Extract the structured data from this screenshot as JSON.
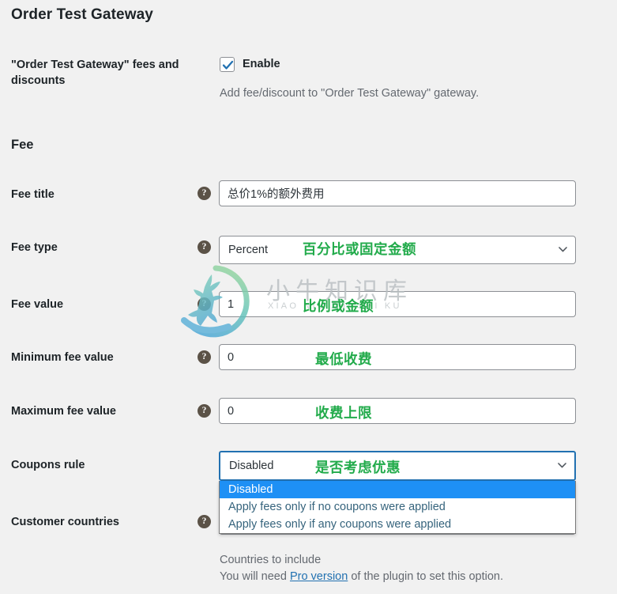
{
  "page": {
    "title": "Order Test Gateway"
  },
  "enable_row": {
    "label": "\"Order Test Gateway\" fees and discounts",
    "checkbox_label": "Enable",
    "checked": true,
    "description": "Add fee/discount to \"Order Test Gateway\" gateway."
  },
  "sections": {
    "fee": "Fee"
  },
  "fields": {
    "fee_title": {
      "label": "Fee title",
      "value": "总价1%的额外费用",
      "help": "?"
    },
    "fee_type": {
      "label": "Fee type",
      "value": "Percent",
      "help": "?",
      "annotation": "百分比或固定金额"
    },
    "fee_value": {
      "label": "Fee value",
      "value": "1",
      "help": "?",
      "annotation": "比例或金额"
    },
    "minimum_fee_value": {
      "label": "Minimum fee value",
      "value": "0",
      "help": "?",
      "annotation": "最低收费"
    },
    "maximum_fee_value": {
      "label": "Maximum fee value",
      "value": "0",
      "help": "?",
      "annotation": "收费上限"
    },
    "coupons_rule": {
      "label": "Coupons rule",
      "value": "Disabled",
      "annotation": "是否考虑优惠",
      "options": [
        "Disabled",
        "Apply fees only if no coupons were applied",
        "Apply fees only if any coupons were applied"
      ],
      "selected_index": 0
    },
    "customer_countries": {
      "label": "Customer countries",
      "help": "?",
      "value": "",
      "description_line1": "Countries to include",
      "description_line2_prefix": "You will need ",
      "description_link": "Pro version",
      "description_line2_suffix": " of the plugin to set this option."
    }
  },
  "watermark": {
    "text_cn": "小牛知识库",
    "text_en": "XIAO NIU ZHI SHI KU"
  },
  "colors": {
    "accent_blue": "#2271b1",
    "highlight_blue": "#1e90f5",
    "annotation_green": "#22ab4b",
    "background": "#f1f1f1"
  }
}
